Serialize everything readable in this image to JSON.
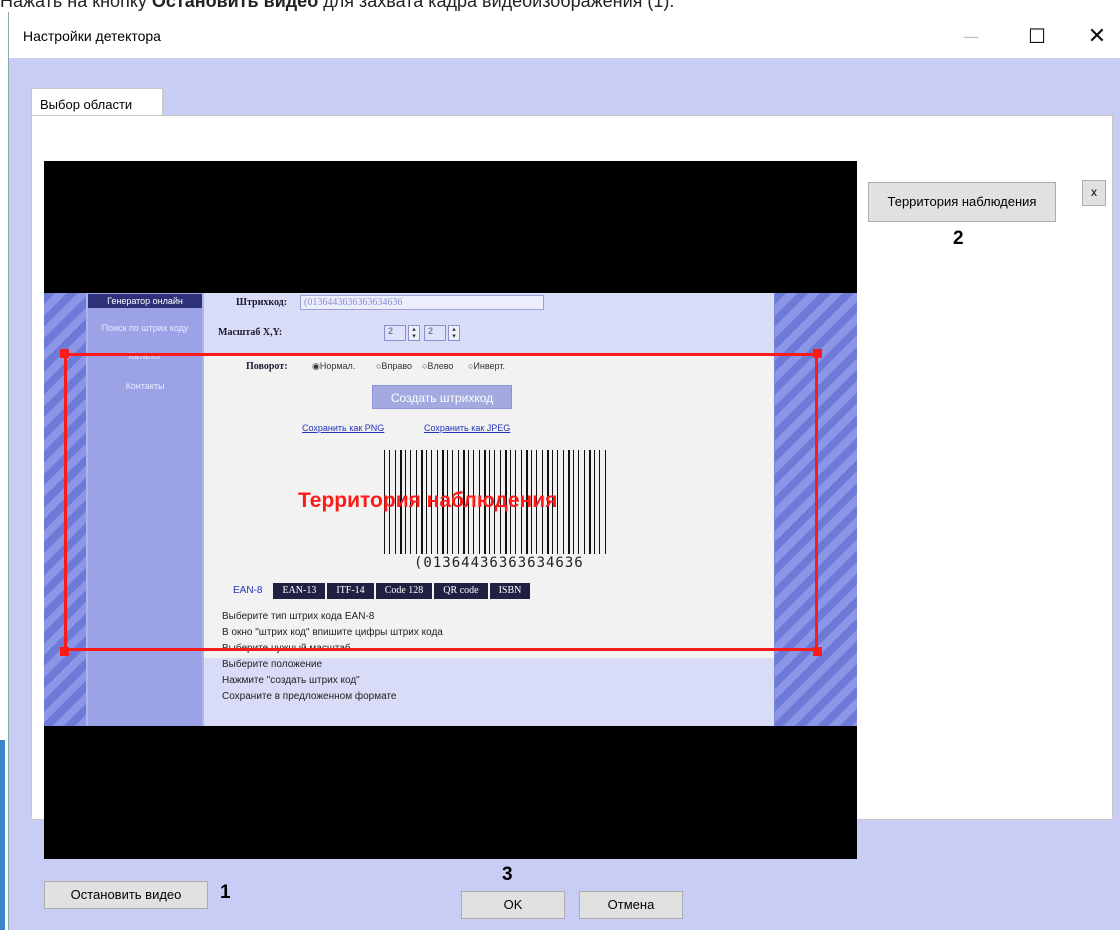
{
  "doc": {
    "prefix": "Нажать на кнопку ",
    "bold": "Остановить видео",
    "suffix": " для захвата кадра видеоизображения (1)."
  },
  "window": {
    "title": "Настройки детектора",
    "minimize": "—",
    "maximize": "☐",
    "close": "✕"
  },
  "tab": {
    "label": "Выбор области"
  },
  "video": {
    "page": {
      "nav": [
        "Генератор онлайн",
        "Поиск по штрих коду",
        "Каталог",
        "Контакты"
      ],
      "barcode_label": "Штрихкод:",
      "barcode_value": "(0136443636363634636",
      "scale_label": "Масштаб X,Y:",
      "scale_x": "2",
      "scale_y": "2",
      "rotation_label": "Поворот:",
      "rotation_options": [
        "◉Нормал.",
        "○Вправо",
        "○Влево",
        "○Инверт."
      ],
      "create_button": "Создать штрихкод",
      "link_png": "Сохранить как PNG",
      "link_jpeg": "Сохранить как JPEG",
      "barcode_text": "(01364436363634636",
      "barcode_tabs": [
        "EAN-8",
        "EAN-13",
        "ITF-14",
        "Code 128",
        "QR code",
        "ISBN"
      ],
      "instructions": [
        "Выберите тип штрих кода  EAN-8",
        "В окно \"штрих код\" впишите цифры штрих кода",
        "Выберите нужный масштаб",
        "Выберите положение",
        "Нажмите \"создать штрих код\"",
        "Сохраните в предложенном формате"
      ]
    },
    "roi_label": "Территория наблюдения",
    "roi_color": "#ff1a1a"
  },
  "zones": {
    "zone_button": "Территория наблюдения",
    "remove_button": "x"
  },
  "buttons": {
    "stop_video": "Остановить видео",
    "ok": "OK",
    "cancel": "Отмена"
  },
  "markers": {
    "one": "1",
    "two": "2",
    "three": "3"
  }
}
